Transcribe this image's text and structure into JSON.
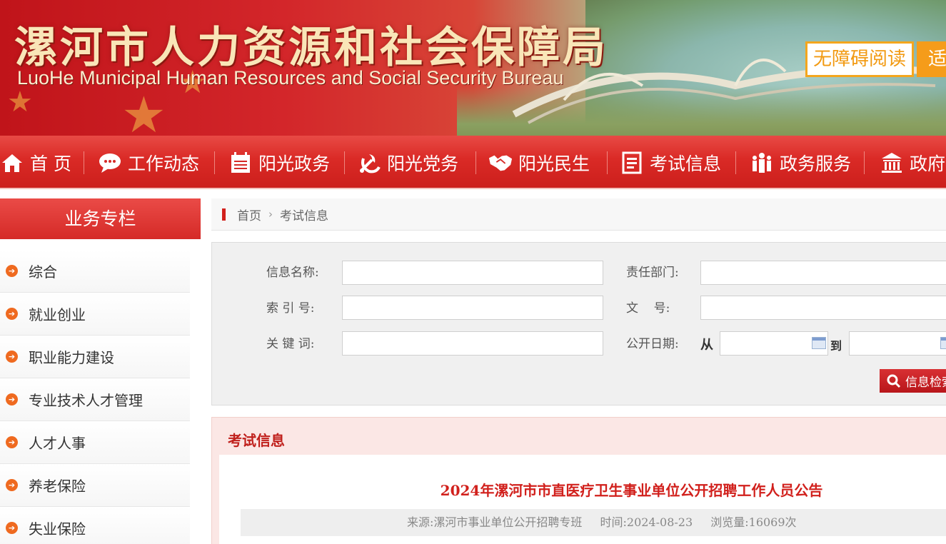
{
  "header": {
    "title_cn": "漯河市人力资源和社会保障局",
    "title_en": "LuoHe Municipal Human Resources and Social Security Bureau",
    "accessible_reading": "无障碍阅读",
    "elder_mode": "适"
  },
  "nav": {
    "items": [
      {
        "label": "首 页",
        "icon": "home-icon"
      },
      {
        "label": "工作动态",
        "icon": "chat-icon"
      },
      {
        "label": "阳光政务",
        "icon": "calendar-icon"
      },
      {
        "label": "阳光党务",
        "icon": "party-emblem-icon"
      },
      {
        "label": "阳光民生",
        "icon": "handshake-icon"
      },
      {
        "label": "考试信息",
        "icon": "document-icon"
      },
      {
        "label": "政务服务",
        "icon": "people-icon"
      },
      {
        "label": "政府信",
        "icon": "government-building-icon"
      }
    ]
  },
  "sidebar": {
    "heading": "业务专栏",
    "items": [
      {
        "label": "综合"
      },
      {
        "label": "就业创业"
      },
      {
        "label": "职业能力建设"
      },
      {
        "label": "专业技术人才管理"
      },
      {
        "label": "人才人事"
      },
      {
        "label": "养老保险"
      },
      {
        "label": "失业保险"
      }
    ]
  },
  "breadcrumb": {
    "home": "首页",
    "current": "考试信息"
  },
  "search": {
    "info_name_label": "信息名称:",
    "info_name_value": "",
    "department_label": "责任部门:",
    "department_value": "",
    "index_no_label": "索 引 号:",
    "index_no_value": "",
    "doc_no_label": "文    号:",
    "doc_no_value": "",
    "keyword_label": "关 键 词:",
    "keyword_value": "",
    "date_label": "公开日期:",
    "from_label": "从",
    "to_label": "到",
    "date_from": "",
    "date_to": "",
    "button_label": "信息检索"
  },
  "exam": {
    "section_title": "考试信息",
    "article_title": "2024年漯河市市直医疗卫生事业单位公开招聘工作人员公告",
    "source": "来源:漯河市事业单位公开招聘专班",
    "time": "时间:2024-08-23",
    "views": "浏览量:16069次"
  },
  "colors": {
    "primary_red": "#d52a27",
    "accent_orange": "#f59c1a",
    "title_red": "#d1201c"
  }
}
